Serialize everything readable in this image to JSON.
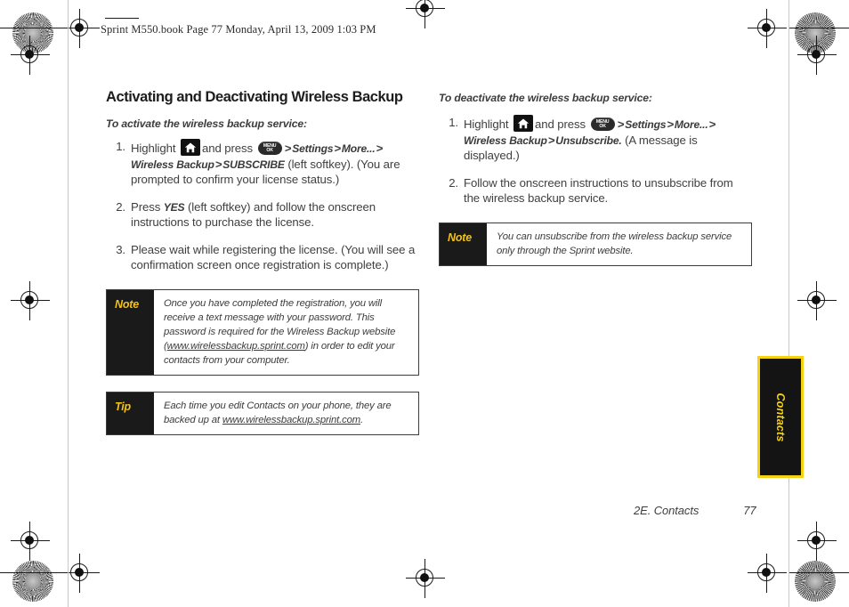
{
  "header": {
    "file_line": "Sprint M550.book  Page 77  Monday, April 13, 2009  1:03 PM"
  },
  "left_column": {
    "section_title": "Activating and Deactivating Wireless Backup",
    "lead_in": "To activate the wireless backup service:",
    "steps": [
      {
        "num": "1.",
        "parts": {
          "t1": "Highlight",
          "icon_home": "home-icon",
          "t2": "and press",
          "icon_menuok": "menu-ok-key-icon",
          "gt1": ">",
          "e1": "Settings",
          "gt2": ">",
          "e2": "More...",
          "gt3": ">",
          "e3": "Wireless Backup",
          "gt4": ">",
          "e4": "SUBSCRIBE",
          "t3": "(left softkey). (You are prompted to confirm your license status.)"
        }
      },
      {
        "num": "2.",
        "parts": {
          "t1": "Press",
          "e1": "YES",
          "t3": "(left softkey) and follow the onscreen instructions to purchase the license."
        }
      },
      {
        "num": "3.",
        "parts": {
          "t1": "Please wait while registering the license. (You will see a confirmation screen once registration is complete.)"
        }
      }
    ],
    "note_box": {
      "label": "Note",
      "text_before": "Once you have completed the registration, you will receive a text message with your password. This password is required for the Wireless Backup website (",
      "url": "www.wirelessbackup.sprint.com",
      "text_after": ") in order to edit your contacts from your computer."
    },
    "tip_box": {
      "label": "Tip",
      "text_before": "Each time you edit Contacts on your phone, they are backed up at ",
      "url": "www.wirelessbackup.sprint.com",
      "text_after": "."
    }
  },
  "right_column": {
    "lead_in": "To deactivate the wireless backup service:",
    "steps": [
      {
        "num": "1.",
        "parts": {
          "t1": "Highlight",
          "icon_home": "home-icon",
          "t2": "and press",
          "icon_menuok": "menu-ok-key-icon",
          "gt1": ">",
          "e1": "Settings",
          "gt2": ">",
          "e2": "More...",
          "gt3": ">",
          "e3": "Wireless Backup",
          "gt4": ">",
          "e4": "Unsubscribe.",
          "t3": "(A message is displayed.)"
        }
      },
      {
        "num": "2.",
        "parts": {
          "t1": "Follow the onscreen instructions to unsubscribe from the wireless backup service."
        }
      }
    ],
    "note_box": {
      "label": "Note",
      "text": "You can unsubscribe from the wireless backup service only through the Sprint website."
    }
  },
  "side_tab": {
    "label": "Contacts"
  },
  "footer": {
    "chapter": "2E. Contacts",
    "page_number": "77"
  },
  "colors": {
    "callout_label_bg": "#1a1a1a",
    "callout_label_text": "#f2c21a",
    "tab_border": "#f5d211",
    "tab_bg": "#141414",
    "body_text": "#404040"
  }
}
